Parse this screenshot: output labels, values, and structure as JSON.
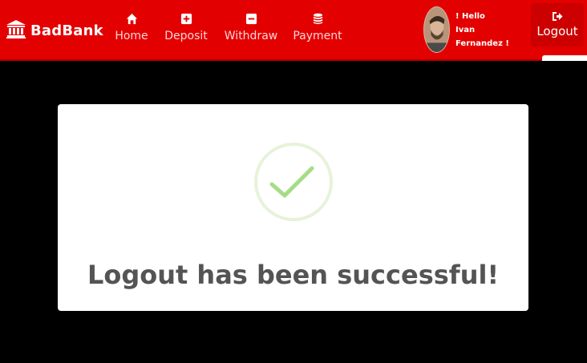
{
  "brand": {
    "name": "BadBank"
  },
  "nav": {
    "items": [
      {
        "label": "Home",
        "icon": "home-icon"
      },
      {
        "label": "Deposit",
        "icon": "plus-square-icon"
      },
      {
        "label": "Withdraw",
        "icon": "minus-square-icon"
      },
      {
        "label": "Payment",
        "icon": "coins-icon"
      }
    ]
  },
  "user": {
    "greeting_line1": "! Hello",
    "greeting_line2": "Ivan",
    "greeting_line3": "Fernandez !"
  },
  "logout": {
    "label": "Logout",
    "icon": "sign-out-icon"
  },
  "modal": {
    "message": "Logout has been successful!",
    "icon": "success-check-icon"
  },
  "colors": {
    "navbar": "#e30000",
    "nav_text": "#ffd6d6",
    "background": "#000000",
    "success_ring": "#e6f3d9",
    "success_check": "#a5dc86",
    "message_text": "#545454"
  }
}
